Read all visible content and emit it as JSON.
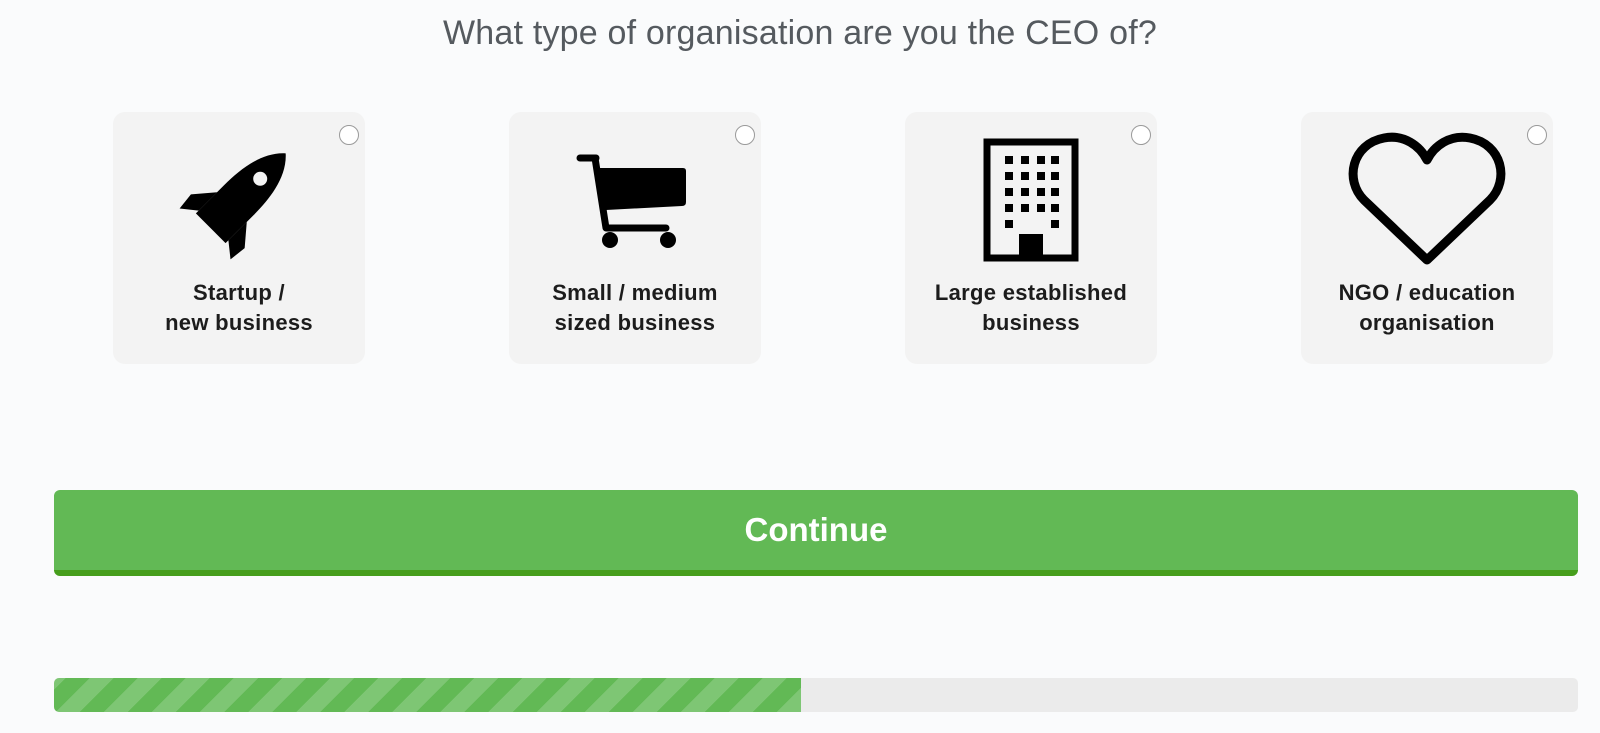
{
  "question": "What type of organisation are you the CEO of?",
  "options": [
    {
      "icon": "rocket-icon",
      "label_line1": "Startup /",
      "label_line2": "new business",
      "selected": false
    },
    {
      "icon": "shopping-cart-icon",
      "label_line1": "Small / medium",
      "label_line2": "sized business",
      "selected": false
    },
    {
      "icon": "office-building-icon",
      "label_line1": "Large established",
      "label_line2": "business",
      "selected": false
    },
    {
      "icon": "heart-icon",
      "label_line1": "NGO / education",
      "label_line2": "organisation",
      "selected": false
    }
  ],
  "continue_label": "Continue",
  "progress": {
    "percent": 49
  },
  "colors": {
    "accent": "#62b955",
    "accent_dark": "#469e1c",
    "card_bg": "#f3f3f3",
    "page_bg": "#fafbfc",
    "progress_track": "#ebebeb"
  }
}
